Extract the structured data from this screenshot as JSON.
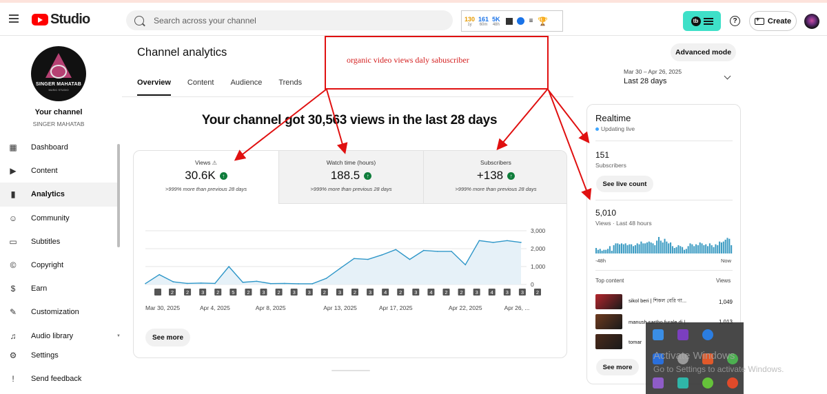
{
  "header": {
    "logo_text": "Studio",
    "search_placeholder": "Search across your channel",
    "extension_stats": [
      {
        "value": "130",
        "period": "1y",
        "color": "#e69a00"
      },
      {
        "value": "161",
        "period": "60m",
        "color": "#1a73e8"
      },
      {
        "value": "5K",
        "period": "48h",
        "color": "#1a73e8"
      }
    ],
    "create_label": "Create",
    "help_label": "?"
  },
  "sidebar": {
    "avatar_text": "SINGER MAHATAB",
    "avatar_subtext": "MUSIC STUDIO",
    "your_channel": "Your channel",
    "channel_name": "SINGER MAHATAB",
    "items": [
      {
        "label": "Dashboard",
        "icon": "dashboard-icon",
        "active": false
      },
      {
        "label": "Content",
        "icon": "content-icon",
        "active": false
      },
      {
        "label": "Analytics",
        "icon": "analytics-icon",
        "active": true
      },
      {
        "label": "Community",
        "icon": "community-icon",
        "active": false
      },
      {
        "label": "Subtitles",
        "icon": "subtitles-icon",
        "active": false
      },
      {
        "label": "Copyright",
        "icon": "copyright-icon",
        "active": false
      },
      {
        "label": "Earn",
        "icon": "earn-icon",
        "active": false
      },
      {
        "label": "Customization",
        "icon": "customization-icon",
        "active": false
      },
      {
        "label": "Audio library",
        "icon": "audio-library-icon",
        "active": false
      }
    ],
    "bottom_items": [
      {
        "label": "Settings",
        "icon": "gear-icon"
      },
      {
        "label": "Send feedback",
        "icon": "feedback-icon"
      }
    ]
  },
  "main": {
    "title": "Channel analytics",
    "tabs": [
      {
        "label": "Overview",
        "active": true
      },
      {
        "label": "Content",
        "active": false
      },
      {
        "label": "Audience",
        "active": false
      },
      {
        "label": "Trends",
        "active": false
      }
    ],
    "advanced_mode_label": "Advanced mode",
    "date_range": "Mar 30 – Apr 26, 2025",
    "date_value": "Last 28 days",
    "headline": "Your channel got 30,563 views in the last 28 days",
    "metrics": [
      {
        "label": "Views",
        "value": "30.6K",
        "change": ">999% more than previous 28 days",
        "warning": true
      },
      {
        "label": "Watch time (hours)",
        "value": "188.5",
        "change": ">999% more than previous 28 days",
        "warning": false
      },
      {
        "label": "Subscribers",
        "value": "+138",
        "change": ">999% more than previous 28 days",
        "warning": false
      }
    ],
    "see_more_label": "See more"
  },
  "chart_data": {
    "type": "area",
    "x": [
      "Mar 30",
      "Mar 31",
      "Apr 1",
      "Apr 2",
      "Apr 3",
      "Apr 4",
      "Apr 5",
      "Apr 6",
      "Apr 7",
      "Apr 8",
      "Apr 9",
      "Apr 10",
      "Apr 11",
      "Apr 12",
      "Apr 13",
      "Apr 14",
      "Apr 15",
      "Apr 16",
      "Apr 17",
      "Apr 18",
      "Apr 19",
      "Apr 20",
      "Apr 21",
      "Apr 22",
      "Apr 23",
      "Apr 24",
      "Apr 25",
      "Apr 26"
    ],
    "values": [
      50,
      550,
      150,
      60,
      80,
      60,
      1000,
      120,
      180,
      50,
      60,
      40,
      40,
      340,
      900,
      1450,
      1400,
      1650,
      1950,
      1400,
      1900,
      1850,
      1850,
      1100,
      2450,
      2350,
      2450,
      2350
    ],
    "x_tick_labels": [
      "Mar 30, 2025",
      "Apr 4, 2025",
      "Apr 8, 2025",
      "Apr 13, 2025",
      "Apr 17, 2025",
      "Apr 22, 2025",
      "Apr 26, ..."
    ],
    "y_ticks": [
      "3,000",
      "2,000",
      "1,000",
      "0"
    ],
    "ylim": [
      0,
      3000
    ],
    "line_color": "#2d96c8",
    "fill_color": "#e6f1f8",
    "upload_markers": [
      "2",
      "2",
      "3",
      "2",
      "5",
      "2",
      "3",
      "2",
      "3",
      "3",
      "2",
      "3",
      "2",
      "3",
      "4",
      "2",
      "3",
      "4",
      "2",
      "2",
      "3",
      "4",
      "3",
      "3",
      "2"
    ]
  },
  "realtime": {
    "title": "Realtime",
    "status": "Updating live",
    "subscribers_value": "151",
    "subscribers_label": "Subscribers",
    "live_count_label": "See live count",
    "views_value": "5,010",
    "views_label": "Views · Last 48 hours",
    "axis_start": "-48h",
    "axis_end": "Now",
    "bar_values": [
      6,
      4,
      5,
      3,
      4,
      4,
      5,
      8,
      3,
      9,
      11,
      11,
      10,
      11,
      10,
      11,
      9,
      10,
      10,
      8,
      9,
      11,
      10,
      13,
      11,
      11,
      12,
      13,
      12,
      11,
      9,
      14,
      18,
      14,
      12,
      16,
      13,
      11,
      12,
      8,
      6,
      7,
      9,
      8,
      7,
      4,
      5,
      8,
      11,
      10,
      8,
      10,
      9,
      12,
      11,
      9,
      10,
      8,
      11,
      9,
      7,
      10,
      9,
      13,
      12,
      13,
      15,
      17,
      16,
      9
    ],
    "top_content_label": "Top content",
    "views_header": "Views",
    "top_content": [
      {
        "title": "sikol beri | শিকল বেরি গা...",
        "views": "1,049",
        "thumb": "#b3262d"
      },
      {
        "title": "manush sartho furale di |...",
        "views": "1,013",
        "thumb": "#6d3a1e"
      },
      {
        "title": "tomar",
        "views": "",
        "thumb": "#4a2a1a"
      }
    ],
    "see_more_label": "See more"
  },
  "annotation": {
    "text": "organic video views daly sabuscriber",
    "color": "#e01010"
  },
  "overlay": {
    "watermark_line1": "Activate Windows",
    "watermark_line2": "Go to Settings to activate Windows."
  }
}
